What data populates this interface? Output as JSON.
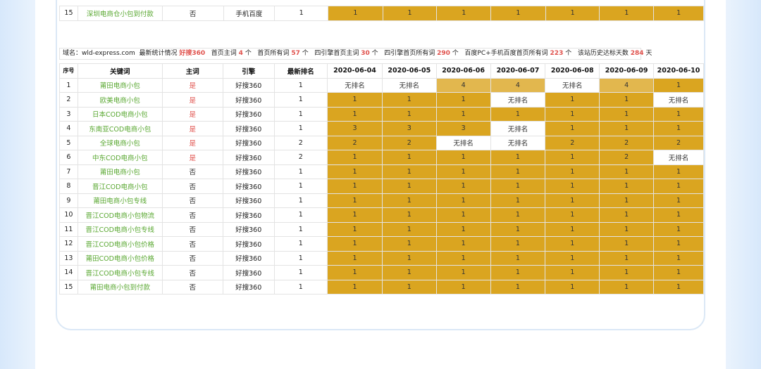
{
  "top_row": {
    "idx": "15",
    "keyword": "深圳电商仓小包到付款",
    "main": "否",
    "engine": "手机百度",
    "rank": "1",
    "cells": [
      "1",
      "1",
      "1",
      "1",
      "1",
      "1",
      "1"
    ]
  },
  "info": {
    "domain_label": "域名：",
    "domain": "wld-express.com",
    "stat_label": "最新统计情况",
    "engine": "好搜360",
    "home_main_label": "首页主词",
    "home_main": "4",
    "unit1": "个",
    "home_all_label": "首页所有词",
    "home_all": "57",
    "unit2": "个",
    "four_main_label": "四引擎首页主词",
    "four_main": "30",
    "unit3": "个",
    "four_all_label": "四引擎首页所有词",
    "four_all": "290",
    "unit4": "个",
    "baidu_label": "百度PC+手机百度首页所有词",
    "baidu_all": "223",
    "unit5": "个",
    "days_label": "该站历史达标天数",
    "days": "284",
    "unit6": "天"
  },
  "table": {
    "headers": {
      "idx": "序号",
      "keyword": "关键词",
      "main": "主词",
      "engine": "引擎",
      "rank": "最新排名"
    },
    "dates": [
      "2020-06-04",
      "2020-06-05",
      "2020-06-06",
      "2020-06-07",
      "2020-06-08",
      "2020-06-09",
      "2020-06-10"
    ],
    "rows": [
      {
        "idx": "1",
        "keyword": "莆田电商小包",
        "main": "是",
        "engine": "好搜360",
        "rank": "1",
        "cells": [
          "无排名",
          "无排名",
          "4",
          "4",
          "无排名",
          "4",
          "1"
        ]
      },
      {
        "idx": "2",
        "keyword": "欧美电商小包",
        "main": "是",
        "engine": "好搜360",
        "rank": "1",
        "cells": [
          "1",
          "1",
          "1",
          "无排名",
          "1",
          "1",
          "无排名"
        ]
      },
      {
        "idx": "3",
        "keyword": "日本COD电商小包",
        "main": "是",
        "engine": "好搜360",
        "rank": "1",
        "cells": [
          "1",
          "1",
          "1",
          "1",
          "1",
          "1",
          "1"
        ]
      },
      {
        "idx": "4",
        "keyword": "东南亚COD电商小包",
        "main": "是",
        "engine": "好搜360",
        "rank": "1",
        "cells": [
          "3",
          "3",
          "3",
          "无排名",
          "1",
          "1",
          "1"
        ]
      },
      {
        "idx": "5",
        "keyword": "全球电商小包",
        "main": "是",
        "engine": "好搜360",
        "rank": "2",
        "cells": [
          "2",
          "2",
          "无排名",
          "无排名",
          "2",
          "2",
          "2"
        ]
      },
      {
        "idx": "6",
        "keyword": "中东COD电商小包",
        "main": "是",
        "engine": "好搜360",
        "rank": "2",
        "cells": [
          "1",
          "1",
          "1",
          "1",
          "1",
          "2",
          "无排名"
        ]
      },
      {
        "idx": "7",
        "keyword": "莆田电商小包",
        "main": "否",
        "engine": "好搜360",
        "rank": "1",
        "cells": [
          "1",
          "1",
          "1",
          "1",
          "1",
          "1",
          "1"
        ]
      },
      {
        "idx": "8",
        "keyword": "晋江COD电商小包",
        "main": "否",
        "engine": "好搜360",
        "rank": "1",
        "cells": [
          "1",
          "1",
          "1",
          "1",
          "1",
          "1",
          "1"
        ]
      },
      {
        "idx": "9",
        "keyword": "莆田电商小包专线",
        "main": "否",
        "engine": "好搜360",
        "rank": "1",
        "cells": [
          "1",
          "1",
          "1",
          "1",
          "1",
          "1",
          "1"
        ]
      },
      {
        "idx": "10",
        "keyword": "晋江COD电商小包物流",
        "main": "否",
        "engine": "好搜360",
        "rank": "1",
        "cells": [
          "1",
          "1",
          "1",
          "1",
          "1",
          "1",
          "1"
        ]
      },
      {
        "idx": "11",
        "keyword": "晋江COD电商小包专线",
        "main": "否",
        "engine": "好搜360",
        "rank": "1",
        "cells": [
          "1",
          "1",
          "1",
          "1",
          "1",
          "1",
          "1"
        ]
      },
      {
        "idx": "12",
        "keyword": "晋江COD电商小包价格",
        "main": "否",
        "engine": "好搜360",
        "rank": "1",
        "cells": [
          "1",
          "1",
          "1",
          "1",
          "1",
          "1",
          "1"
        ]
      },
      {
        "idx": "13",
        "keyword": "莆田COD电商小包价格",
        "main": "否",
        "engine": "好搜360",
        "rank": "1",
        "cells": [
          "1",
          "1",
          "1",
          "1",
          "1",
          "1",
          "1"
        ]
      },
      {
        "idx": "14",
        "keyword": "晋江COD电商小包专线",
        "main": "否",
        "engine": "好搜360",
        "rank": "1",
        "cells": [
          "1",
          "1",
          "1",
          "1",
          "1",
          "1",
          "1"
        ]
      },
      {
        "idx": "15",
        "keyword": "莆田电商小包到付款",
        "main": "否",
        "engine": "好搜360",
        "rank": "1",
        "cells": [
          "1",
          "1",
          "1",
          "1",
          "1",
          "1",
          "1"
        ]
      }
    ]
  },
  "colors": {
    "gold": "#daa520",
    "light_gold": "#e2b74e",
    "red": "#e0524d",
    "green": "#5aa832"
  }
}
